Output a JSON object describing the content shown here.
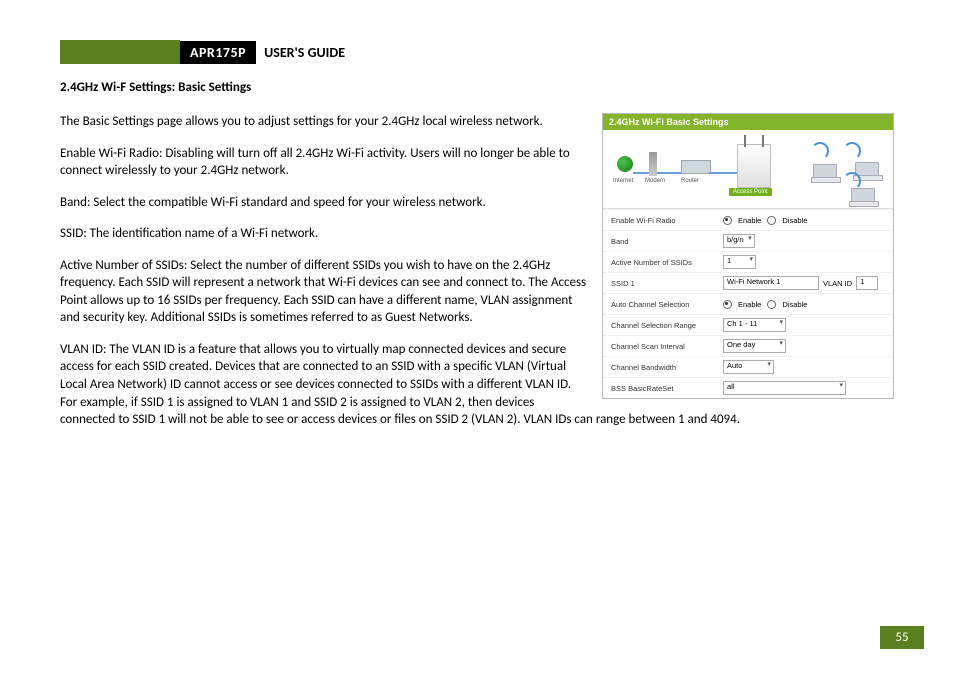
{
  "header": {
    "model": "APR175P",
    "guide": "USER'S GUIDE"
  },
  "section_title": "2.4GHz Wi-F Settings: Basic Settings",
  "paragraphs": {
    "p1": "The Basic Settings page allows you to adjust settings for your 2.4GHz local wireless network.",
    "p2": "Enable Wi-Fi Radio: Disabling will turn off all 2.4GHz Wi-Fi activity. Users will no longer be able to connect wirelessly to your 2.4GHz network.",
    "p3": "Band: Select the compatible Wi-Fi standard and speed for your wireless network.",
    "p4": "SSID: The identification name of a Wi-Fi network.",
    "p5": "Active Number of SSIDs: Select the number of different SSIDs you wish to have on the 2.4GHz frequency.  Each SSID will represent a network that Wi-Fi devices can see and connect to.  The Access Point allows up to 16 SSIDs per frequency.  Each SSID can have a different name, VLAN assignment and security key. Additional SSIDs is sometimes referred to as Guest Networks.",
    "p6": "VLAN ID: The VLAN ID is a feature that allows you to virtually map connected devices and secure access for each SSID created.  Devices that are connected to an SSID with a specific VLAN (Virtual Local Area Network) ID cannot access or see devices connected to SSIDs with a different VLAN ID.  For example, if SSID 1 is assigned to VLAN 1 and SSID 2 is assigned to VLAN 2, then devices connected to SSID 1 will not be able to see or access devices or files on SSID 2 (VLAN 2).  VLAN IDs can range between 1 and 4094."
  },
  "figure": {
    "title": "2.4GHz Wi-Fi Basic Settings",
    "diagram_labels": {
      "internet": "Internet",
      "modem": "Modem",
      "router": "Router",
      "ap": "Access Point"
    },
    "rows": {
      "enable_label": "Enable Wi-Fi Radio",
      "enable_opt_on": "Enable",
      "enable_opt_off": "Disable",
      "band_label": "Band",
      "band_value": "b/g/n",
      "active_label": "Active Number of SSIDs",
      "active_value": "1",
      "ssid1_label": "SSID 1",
      "ssid1_value": "Wi-Fi Network 1",
      "vlan_label": "VLAN ID",
      "vlan_value": "1",
      "auto_ch_label": "Auto Channel Selection",
      "auto_ch_on": "Enable",
      "auto_ch_off": "Disable",
      "ch_range_label": "Channel Selection Range",
      "ch_range_value": "Ch 1 - 11",
      "scan_label": "Channel Scan Interval",
      "scan_value": "One day",
      "bw_label": "Channel Bandwidth",
      "bw_value": "Auto",
      "bss_label": "BSS BasicRateSet",
      "bss_value": "all"
    }
  },
  "page_number": "55"
}
